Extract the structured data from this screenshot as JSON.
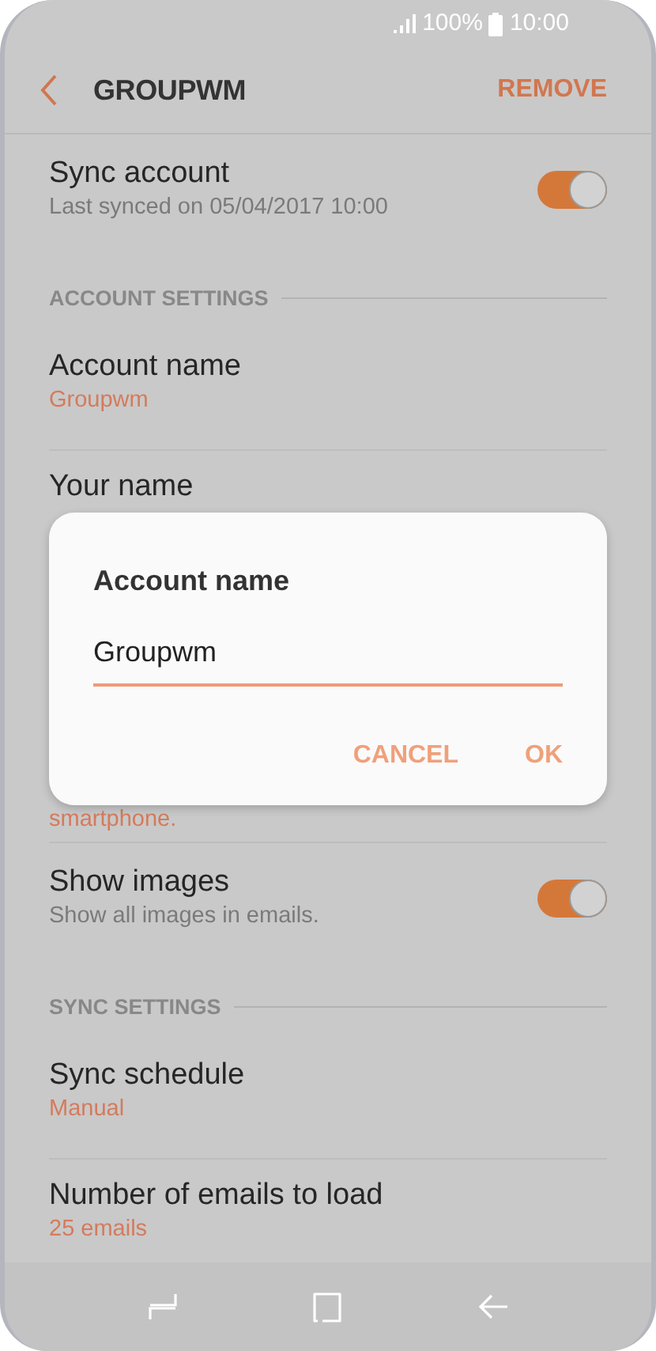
{
  "status_bar": {
    "battery": "100%",
    "time": "10:00"
  },
  "header": {
    "title": "GROUPWM",
    "action": "REMOVE"
  },
  "items": [
    {
      "kind": "toggle",
      "title": "Sync account",
      "subtitle": "Last synced on 05/04/2017  10:00",
      "on": true
    },
    {
      "kind": "section",
      "title": "ACCOUNT SETTINGS"
    },
    {
      "kind": "value",
      "title": "Account name",
      "value_lines": [
        "Groupwm"
      ]
    },
    {
      "kind": "value",
      "title": "Your name"
    },
    {
      "kind": "covered"
    },
    {
      "kind": "covered",
      "value_lines": [
        "smartphone."
      ]
    },
    {
      "kind": "toggle",
      "title": "Show images",
      "subtitle": "Show all images in emails.",
      "on": true
    },
    {
      "kind": "section",
      "title": "SYNC SETTINGS"
    },
    {
      "kind": "value",
      "title": "Sync schedule",
      "value_lines": [
        "Manual"
      ]
    },
    {
      "kind": "value",
      "title": "Number of emails to load",
      "value_lines": [
        "25 emails"
      ]
    }
  ],
  "dialog": {
    "title": "Account name",
    "value": "Groupwm",
    "buttons": [
      "CANCEL",
      "OK"
    ]
  }
}
